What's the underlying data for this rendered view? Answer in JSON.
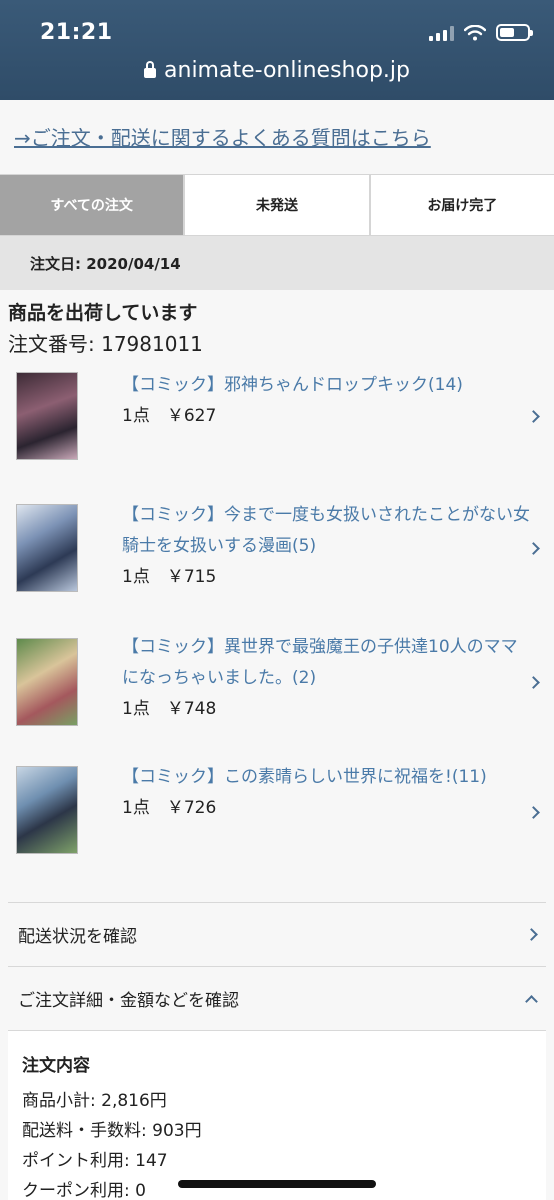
{
  "status_bar": {
    "time": "21:21",
    "icons": [
      "signal-icon",
      "wifi-icon",
      "battery-icon"
    ]
  },
  "browser": {
    "url": "animate-onlineshop.jp"
  },
  "faq_link": "→ご注文・配送に関するよくある質問はこちら",
  "tabs": [
    {
      "label": "すべての注文",
      "active": true
    },
    {
      "label": "未発送",
      "active": false
    },
    {
      "label": "お届け完了",
      "active": false
    }
  ],
  "order_date": "注文日: 2020/04/14",
  "shipping_status": "商品を出荷しています",
  "order_number": "注文番号: 17981011",
  "items": [
    {
      "title": "【コミック】邪神ちゃんドロップキック(14)",
      "price": "1点　￥627"
    },
    {
      "title": "【コミック】今まで一度も女扱いされたことがない女騎士を女扱いする漫画(5)",
      "price": "1点　￥715"
    },
    {
      "title": "【コミック】異世界で最強魔王の子供達10人のママになっちゃいました。(2)",
      "price": "1点　￥748"
    },
    {
      "title": "【コミック】この素晴らしい世界に祝福を!(11)",
      "price": "1点　￥726"
    }
  ],
  "links": {
    "delivery_status": "配送状況を確認",
    "order_details": "ご注文詳細・金額などを確認"
  },
  "details": {
    "heading": "注文内容",
    "subtotal": "商品小計: 2,816円",
    "shipping_fee": "配送料・手数料: 903円",
    "points_used": "ポイント利用: 147",
    "coupon_used": "クーポン利用: 0"
  },
  "colors": {
    "header_bg": "#2f4c68",
    "link": "#4a7aa8",
    "active_tab": "#a3a3a3"
  }
}
